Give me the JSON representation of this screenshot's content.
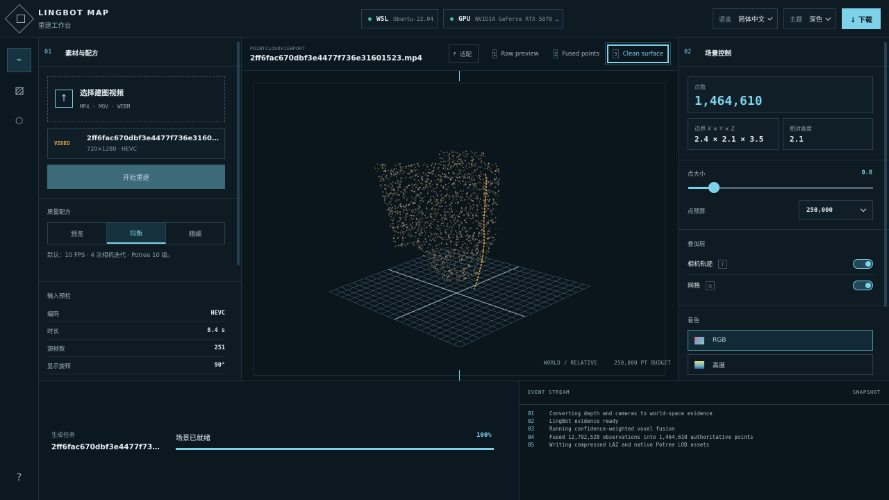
{
  "app": {
    "brand": "LINGBOT MAP",
    "subtitle": "重建工作台"
  },
  "status": {
    "wsl_label": "WSL",
    "wsl_value": "Ubuntu-22.04",
    "gpu_label": "GPU",
    "gpu_value": "NVIDIA GeForce RTX 5070 …"
  },
  "header": {
    "language_label": "语言",
    "language_value": "简体中文",
    "theme_label": "主题",
    "theme_value": "深色",
    "download_label": "↓ 下载"
  },
  "rail": {
    "help": "?"
  },
  "left_panel": {
    "section_num": "01",
    "section_title": "素材与配方",
    "upload_title": "选择建图视频",
    "upload_formats": "MP4 · MOV · WEBM",
    "video_tag": "VIDEO",
    "video_name": "2ff6fac670dbf3e4477f736e3160152...",
    "video_meta": "720×1280 · HEVC",
    "start_button": "开始重建",
    "quality_label": "质量配方",
    "quality_options": [
      "预览",
      "均衡",
      "精细"
    ],
    "quality_selected": "均衡",
    "quality_note": "默认：10 FPS · 4 次相机迭代 · Potree 10 级。",
    "inspect_label": "输入预检",
    "inspect_rows": [
      {
        "k": "编码",
        "v": "HEVC"
      },
      {
        "k": "时长",
        "v": "8.4 s"
      },
      {
        "k": "源帧数",
        "v": "251"
      },
      {
        "k": "显示旋转",
        "v": "90°"
      }
    ]
  },
  "viewport": {
    "label": "POINTCLOUDVIEWPORT",
    "file": "2ff6fac670dbf3e4477f736e31601523.mp4",
    "fit_key": "F",
    "fit_label": "适配",
    "modes": [
      {
        "key": "1",
        "label": "Raw preview"
      },
      {
        "key": "2",
        "label": "Fused points"
      },
      {
        "key": "3",
        "label": "Clean surface"
      }
    ],
    "active_mode": "Clean surface",
    "footer": "WORLD / RELATIVE     250,000 PT BUDGET"
  },
  "right_panel": {
    "section_num": "02",
    "section_title": "场景控制",
    "points_label": "点数",
    "points_value": "1,464,610",
    "bounds_label": "边界 X × Y × Z",
    "bounds_value": "2.4 × 2.1 × 3.5",
    "height_label": "相对高度",
    "height_value": "2.1",
    "point_size_label": "点大小",
    "point_size_value": "0.8",
    "point_size_fraction": 0.14,
    "budget_label": "点预算",
    "budget_value": "250,000",
    "overlays_label": "叠加层",
    "overlays": [
      {
        "label": "相机轨迹",
        "key": "T",
        "on": true
      },
      {
        "label": "网格",
        "key": "G",
        "on": true
      }
    ],
    "color_label": "着色",
    "color_options": [
      {
        "label": "RGB",
        "selected": true
      },
      {
        "label": "高度",
        "selected": false
      }
    ]
  },
  "job": {
    "label": "生成任务",
    "name": "2ff6fac670dbf3e4477f736...",
    "status": "场景已就绪",
    "progress_text": "100%",
    "progress": 1.0
  },
  "events": {
    "title": "EVENT STREAM",
    "snapshot": "SNAPSHOT",
    "lines": [
      {
        "n": "01",
        "text": "Converting depth and cameras to world-space evidence"
      },
      {
        "n": "02",
        "text": "LingBot evidence ready"
      },
      {
        "n": "03",
        "text": "Running confidence-weighted voxel fusion"
      },
      {
        "n": "04",
        "text": "Fused 12,792,528 observations into 1,464,610 authoritative points"
      },
      {
        "n": "05",
        "text": "Writing compressed LAZ and native Potree LOD assets"
      }
    ]
  },
  "colors": {
    "accent": "#7dd1e8",
    "ok": "#3fc49a",
    "warn": "#e0a44a",
    "bg": "#0c1820"
  }
}
